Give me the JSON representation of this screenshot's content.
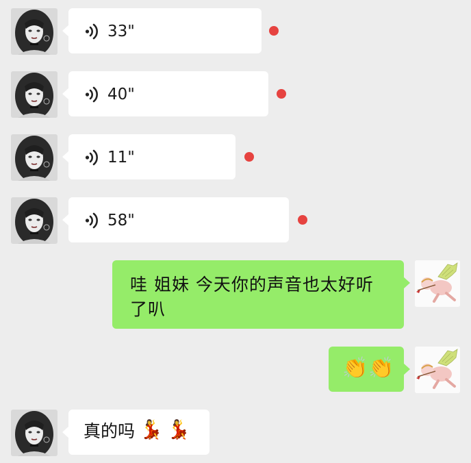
{
  "messages": {
    "voice": [
      {
        "duration": "33\""
      },
      {
        "duration": "40\""
      },
      {
        "duration": "11\""
      },
      {
        "duration": "58\""
      }
    ],
    "outgoing_text": "哇 姐妹 今天你的声音也太好听了叭",
    "outgoing_emoji": [
      "👏",
      "👏"
    ],
    "reply_text": "真的吗",
    "reply_emoji": [
      "💃",
      "💃"
    ]
  },
  "icons": {
    "voice": "voice-wave-icon",
    "unread": "unread-dot",
    "avatar_contact": "contact-avatar",
    "avatar_self": "cupid-avatar"
  },
  "colors": {
    "background": "#ededed",
    "incoming_bubble": "#ffffff",
    "outgoing_bubble": "#95ec69",
    "unread_dot": "#e64340"
  }
}
